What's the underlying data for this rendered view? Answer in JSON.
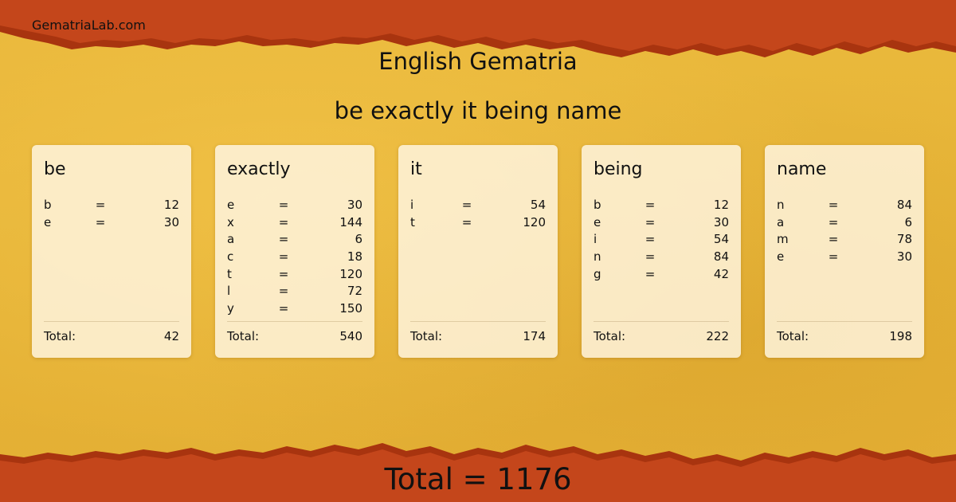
{
  "site": {
    "name": "GematriaLab.com"
  },
  "title": "English Gematria",
  "phrase": "be exactly it being name",
  "words": [
    {
      "word": "be",
      "letters": [
        {
          "letter": "b",
          "value": "12"
        },
        {
          "letter": "e",
          "value": "30"
        }
      ],
      "total_label": "Total:",
      "total": "42"
    },
    {
      "word": "exactly",
      "letters": [
        {
          "letter": "e",
          "value": "30"
        },
        {
          "letter": "x",
          "value": "144"
        },
        {
          "letter": "a",
          "value": "6"
        },
        {
          "letter": "c",
          "value": "18"
        },
        {
          "letter": "t",
          "value": "120"
        },
        {
          "letter": "l",
          "value": "72"
        },
        {
          "letter": "y",
          "value": "150"
        }
      ],
      "total_label": "Total:",
      "total": "540"
    },
    {
      "word": "it",
      "letters": [
        {
          "letter": "i",
          "value": "54"
        },
        {
          "letter": "t",
          "value": "120"
        }
      ],
      "total_label": "Total:",
      "total": "174"
    },
    {
      "word": "being",
      "letters": [
        {
          "letter": "b",
          "value": "12"
        },
        {
          "letter": "e",
          "value": "30"
        },
        {
          "letter": "i",
          "value": "54"
        },
        {
          "letter": "n",
          "value": "84"
        },
        {
          "letter": "g",
          "value": "42"
        }
      ],
      "total_label": "Total:",
      "total": "222"
    },
    {
      "word": "name",
      "letters": [
        {
          "letter": "n",
          "value": "84"
        },
        {
          "letter": "a",
          "value": "6"
        },
        {
          "letter": "m",
          "value": "78"
        },
        {
          "letter": "e",
          "value": "30"
        }
      ],
      "total_label": "Total:",
      "total": "198"
    }
  ],
  "equals_sign": "=",
  "grand_total": "Total = 1176",
  "colors": {
    "background": "#e7b63a",
    "band": "#c3441a",
    "band_dark": "#a3300f",
    "card": "#fbf0d8"
  }
}
